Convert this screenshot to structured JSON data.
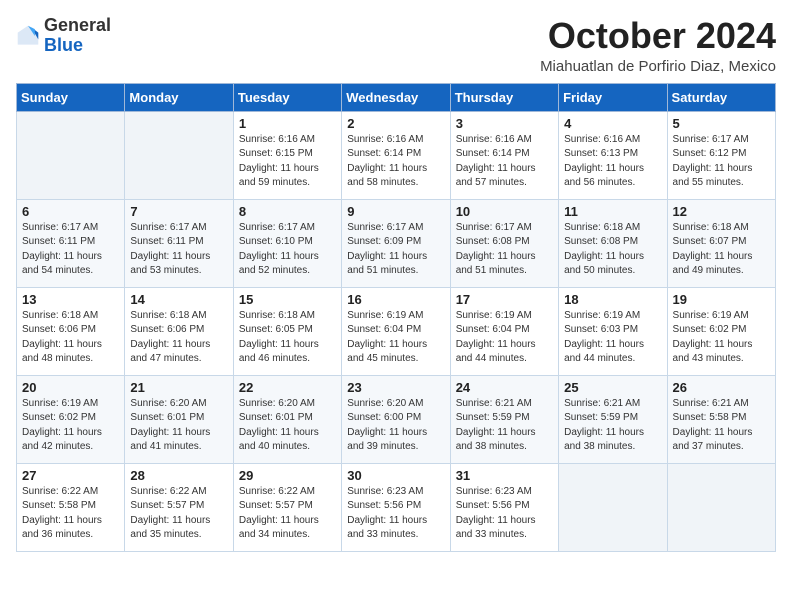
{
  "logo": {
    "general": "General",
    "blue": "Blue"
  },
  "header": {
    "month_title": "October 2024",
    "location": "Miahuatlan de Porfirio Diaz, Mexico"
  },
  "weekdays": [
    "Sunday",
    "Monday",
    "Tuesday",
    "Wednesday",
    "Thursday",
    "Friday",
    "Saturday"
  ],
  "weeks": [
    [
      {
        "day": "",
        "content": ""
      },
      {
        "day": "",
        "content": ""
      },
      {
        "day": "1",
        "content": "Sunrise: 6:16 AM\nSunset: 6:15 PM\nDaylight: 11 hours and 59 minutes."
      },
      {
        "day": "2",
        "content": "Sunrise: 6:16 AM\nSunset: 6:14 PM\nDaylight: 11 hours and 58 minutes."
      },
      {
        "day": "3",
        "content": "Sunrise: 6:16 AM\nSunset: 6:14 PM\nDaylight: 11 hours and 57 minutes."
      },
      {
        "day": "4",
        "content": "Sunrise: 6:16 AM\nSunset: 6:13 PM\nDaylight: 11 hours and 56 minutes."
      },
      {
        "day": "5",
        "content": "Sunrise: 6:17 AM\nSunset: 6:12 PM\nDaylight: 11 hours and 55 minutes."
      }
    ],
    [
      {
        "day": "6",
        "content": "Sunrise: 6:17 AM\nSunset: 6:11 PM\nDaylight: 11 hours and 54 minutes."
      },
      {
        "day": "7",
        "content": "Sunrise: 6:17 AM\nSunset: 6:11 PM\nDaylight: 11 hours and 53 minutes."
      },
      {
        "day": "8",
        "content": "Sunrise: 6:17 AM\nSunset: 6:10 PM\nDaylight: 11 hours and 52 minutes."
      },
      {
        "day": "9",
        "content": "Sunrise: 6:17 AM\nSunset: 6:09 PM\nDaylight: 11 hours and 51 minutes."
      },
      {
        "day": "10",
        "content": "Sunrise: 6:17 AM\nSunset: 6:08 PM\nDaylight: 11 hours and 51 minutes."
      },
      {
        "day": "11",
        "content": "Sunrise: 6:18 AM\nSunset: 6:08 PM\nDaylight: 11 hours and 50 minutes."
      },
      {
        "day": "12",
        "content": "Sunrise: 6:18 AM\nSunset: 6:07 PM\nDaylight: 11 hours and 49 minutes."
      }
    ],
    [
      {
        "day": "13",
        "content": "Sunrise: 6:18 AM\nSunset: 6:06 PM\nDaylight: 11 hours and 48 minutes."
      },
      {
        "day": "14",
        "content": "Sunrise: 6:18 AM\nSunset: 6:06 PM\nDaylight: 11 hours and 47 minutes."
      },
      {
        "day": "15",
        "content": "Sunrise: 6:18 AM\nSunset: 6:05 PM\nDaylight: 11 hours and 46 minutes."
      },
      {
        "day": "16",
        "content": "Sunrise: 6:19 AM\nSunset: 6:04 PM\nDaylight: 11 hours and 45 minutes."
      },
      {
        "day": "17",
        "content": "Sunrise: 6:19 AM\nSunset: 6:04 PM\nDaylight: 11 hours and 44 minutes."
      },
      {
        "day": "18",
        "content": "Sunrise: 6:19 AM\nSunset: 6:03 PM\nDaylight: 11 hours and 44 minutes."
      },
      {
        "day": "19",
        "content": "Sunrise: 6:19 AM\nSunset: 6:02 PM\nDaylight: 11 hours and 43 minutes."
      }
    ],
    [
      {
        "day": "20",
        "content": "Sunrise: 6:19 AM\nSunset: 6:02 PM\nDaylight: 11 hours and 42 minutes."
      },
      {
        "day": "21",
        "content": "Sunrise: 6:20 AM\nSunset: 6:01 PM\nDaylight: 11 hours and 41 minutes."
      },
      {
        "day": "22",
        "content": "Sunrise: 6:20 AM\nSunset: 6:01 PM\nDaylight: 11 hours and 40 minutes."
      },
      {
        "day": "23",
        "content": "Sunrise: 6:20 AM\nSunset: 6:00 PM\nDaylight: 11 hours and 39 minutes."
      },
      {
        "day": "24",
        "content": "Sunrise: 6:21 AM\nSunset: 5:59 PM\nDaylight: 11 hours and 38 minutes."
      },
      {
        "day": "25",
        "content": "Sunrise: 6:21 AM\nSunset: 5:59 PM\nDaylight: 11 hours and 38 minutes."
      },
      {
        "day": "26",
        "content": "Sunrise: 6:21 AM\nSunset: 5:58 PM\nDaylight: 11 hours and 37 minutes."
      }
    ],
    [
      {
        "day": "27",
        "content": "Sunrise: 6:22 AM\nSunset: 5:58 PM\nDaylight: 11 hours and 36 minutes."
      },
      {
        "day": "28",
        "content": "Sunrise: 6:22 AM\nSunset: 5:57 PM\nDaylight: 11 hours and 35 minutes."
      },
      {
        "day": "29",
        "content": "Sunrise: 6:22 AM\nSunset: 5:57 PM\nDaylight: 11 hours and 34 minutes."
      },
      {
        "day": "30",
        "content": "Sunrise: 6:23 AM\nSunset: 5:56 PM\nDaylight: 11 hours and 33 minutes."
      },
      {
        "day": "31",
        "content": "Sunrise: 6:23 AM\nSunset: 5:56 PM\nDaylight: 11 hours and 33 minutes."
      },
      {
        "day": "",
        "content": ""
      },
      {
        "day": "",
        "content": ""
      }
    ]
  ]
}
